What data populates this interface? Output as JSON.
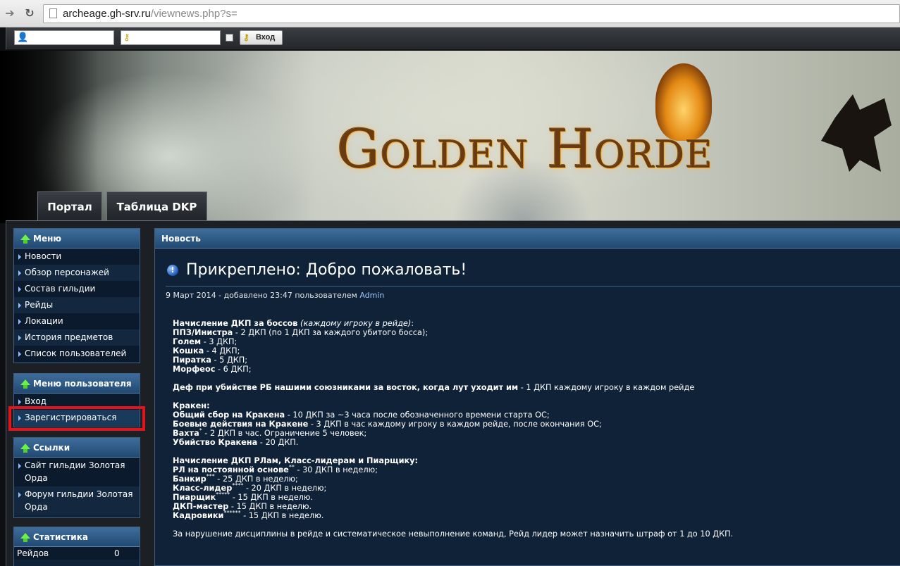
{
  "browser": {
    "url_host": "archeage.gh-srv.ru",
    "url_rest": "/viewnews.php?s="
  },
  "login": {
    "submit_label": "Вход"
  },
  "banner": {
    "brand_text": "Golden Horde"
  },
  "tabs": [
    {
      "label": "Портал"
    },
    {
      "label": "Таблица DKP"
    }
  ],
  "sidebar": {
    "menu": {
      "title": "Меню",
      "items": [
        "Новости",
        "Обзор персонажей",
        "Состав гильдии",
        "Рейды",
        "Локации",
        "История предметов",
        "Список пользователей"
      ]
    },
    "user_menu": {
      "title": "Меню пользователя",
      "items": [
        "Вход",
        "Зарегистрироваться"
      ]
    },
    "links": {
      "title": "Ссылки",
      "items": [
        "Сайт гильдии Золотая Орда",
        "Форум гильдии Золотая Орда"
      ]
    },
    "stats": {
      "title": "Статистика",
      "rows": [
        {
          "label": "Рейдов",
          "value": "0"
        }
      ]
    }
  },
  "news": {
    "header": "Новость",
    "title": "Прикреплено: Добро пожаловать!",
    "meta_prefix": "9 Март 2014 - добавлено 23:47 пользователем",
    "author": "Admin",
    "body": {
      "l1_b": "Начисление ДКП за боссов",
      "l1_i": "(каждому игроку в рейде)",
      "l1_t": ":",
      "l2_b": "ППЗ/Иниcтра",
      "l2_t": " - 2 ДКП (по 1 ДКП за каждого убитого босса);",
      "l3_b": "Голем",
      "l3_t": " - 3 ДКП;",
      "l4_b": "Кошка",
      "l4_t": " - 4 ДКП;",
      "l5_b": "Пиратка",
      "l5_t": " - 5 ДКП;",
      "l6_b": "Морфеос",
      "l6_t": " - 6 ДКП;",
      "l7_b": "Деф при убийстве РБ нашими союзниками за восток, когда лут уходит им",
      "l7_t": " - 1 ДКП каждому игроку в каждом рейде",
      "l8_b": "Кракен:",
      "l9_b": "Общий сбор на Кракена",
      "l9_t": " - 10 ДКП за ~3 часа после обозначенного времени старта ОС;",
      "l10_b": "Боевые действия на Кракене",
      "l10_t": " - 3 ДКП в час каждому игроку в каждом рейде, после окончания ОС;",
      "l11_b": "Вахта",
      "l11_s": "*",
      "l11_t": " - 2 ДКП в час. Ограничение 5 человек;",
      "l12_b": "Убийство Кракена",
      "l12_t": " - 20 ДКП.",
      "l13_b": "Начисление ДКП РЛам, Класс-лидерам и Пиарщику:",
      "l14_b": "РЛ на постоянной основе",
      "l14_s": "**",
      "l14_t": " - 30 ДКП в неделю;",
      "l15_b": "Банкир",
      "l15_s": "***",
      "l15_t": " - 25 ДКП в неделю;",
      "l16_b": "Класс-лидер",
      "l16_s": "****",
      "l16_t": " - 20 ДКП в неделю;",
      "l17_b": "Пиарщик",
      "l17_s": "*****",
      "l17_t": " - 15 ДКП в неделю.",
      "l18_b": "ДКП-мастер",
      "l18_t": " - 15 ДКП в неделю.",
      "l19_b": "Кадровики",
      "l19_s": "******",
      "l19_t": " - 15 ДКП в неделю.",
      "l20_t": "За нарушение дисциплины в рейде и систематическое невыполнение команд, Рейд лидер может назначить штраф от 1 до 10 ДКП."
    }
  },
  "colors": {
    "panel_bg": "#0f2238",
    "header_blue": "#2f5b87",
    "highlight_red": "#e0141c",
    "link_blue": "#9ec8ff"
  }
}
